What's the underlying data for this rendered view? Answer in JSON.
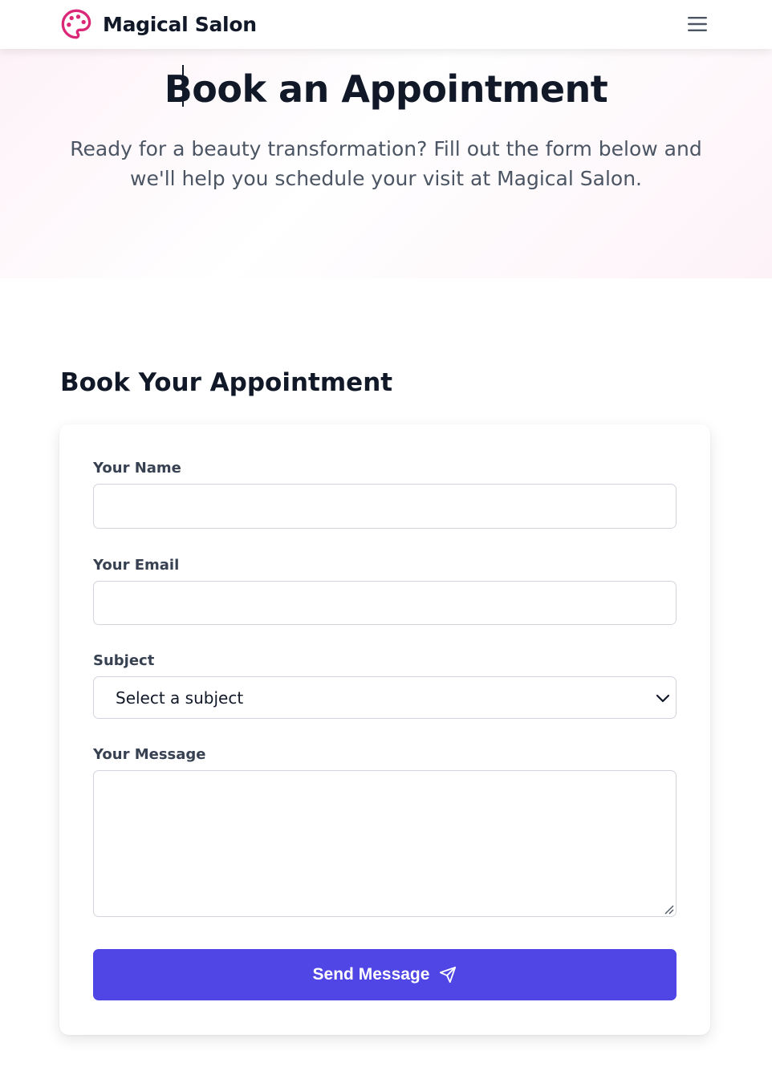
{
  "nav": {
    "brand_name": "Magical Salon",
    "brand_icon": "palette-icon",
    "menu_icon": "hamburger-menu-icon"
  },
  "hero": {
    "title": "Book an Appointment",
    "subtitle": "Ready for a beauty transformation? Fill out the form below and we'll help you schedule your visit at Magical Salon."
  },
  "form": {
    "section_title": "Book Your Appointment",
    "name_label": "Your Name",
    "name_value": "",
    "email_label": "Your Email",
    "email_value": "",
    "subject_label": "Subject",
    "subject_selected": "Select a subject",
    "message_label": "Your Message",
    "message_value": "",
    "submit_label": "Send Message",
    "submit_icon": "send-icon"
  },
  "colors": {
    "brand_accent": "#db2777",
    "button": "#4f46e5",
    "hero_tint": "#fdf2f8"
  }
}
